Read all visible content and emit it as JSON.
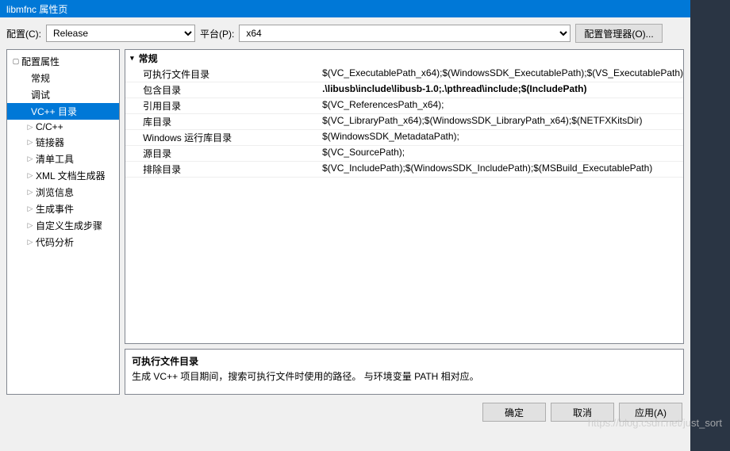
{
  "titlebar": {
    "title": "libmfnc 属性页"
  },
  "toolbar": {
    "config_label": "配置(C):",
    "config_value": "Release",
    "platform_label": "平台(P):",
    "platform_value": "x64",
    "config_manager": "配置管理器(O)..."
  },
  "tree": {
    "root": "配置属性",
    "items": [
      {
        "label": "常规",
        "expandable": false
      },
      {
        "label": "调试",
        "expandable": false
      },
      {
        "label": "VC++ 目录",
        "expandable": false,
        "selected": true
      },
      {
        "label": "C/C++",
        "expandable": true
      },
      {
        "label": "链接器",
        "expandable": true
      },
      {
        "label": "清单工具",
        "expandable": true
      },
      {
        "label": "XML 文档生成器",
        "expandable": true
      },
      {
        "label": "浏览信息",
        "expandable": true
      },
      {
        "label": "生成事件",
        "expandable": true
      },
      {
        "label": "自定义生成步骤",
        "expandable": true
      },
      {
        "label": "代码分析",
        "expandable": true
      }
    ]
  },
  "grid": {
    "section": "常规",
    "rows": [
      {
        "label": "可执行文件目录",
        "value": "$(VC_ExecutablePath_x64);$(WindowsSDK_ExecutablePath);$(VS_ExecutablePath)"
      },
      {
        "label": "包含目录",
        "value": ".\\libusb\\include\\libusb-1.0;.\\pthread\\include;$(IncludePath)",
        "bold": true
      },
      {
        "label": "引用目录",
        "value": "$(VC_ReferencesPath_x64);"
      },
      {
        "label": "库目录",
        "value": "$(VC_LibraryPath_x64);$(WindowsSDK_LibraryPath_x64);$(NETFXKitsDir)"
      },
      {
        "label": "Windows 运行库目录",
        "value": "$(WindowsSDK_MetadataPath);"
      },
      {
        "label": "源目录",
        "value": "$(VC_SourcePath);"
      },
      {
        "label": "排除目录",
        "value": "$(VC_IncludePath);$(WindowsSDK_IncludePath);$(MSBuild_ExecutablePath)"
      }
    ]
  },
  "description": {
    "title": "可执行文件目录",
    "text": "生成 VC++ 项目期间，搜索可执行文件时使用的路径。   与环境变量 PATH 相对应。"
  },
  "footer": {
    "ok": "确定",
    "cancel": "取消",
    "apply": "应用(A)"
  },
  "watermark": "https://blog.csdn.net/just_sort"
}
